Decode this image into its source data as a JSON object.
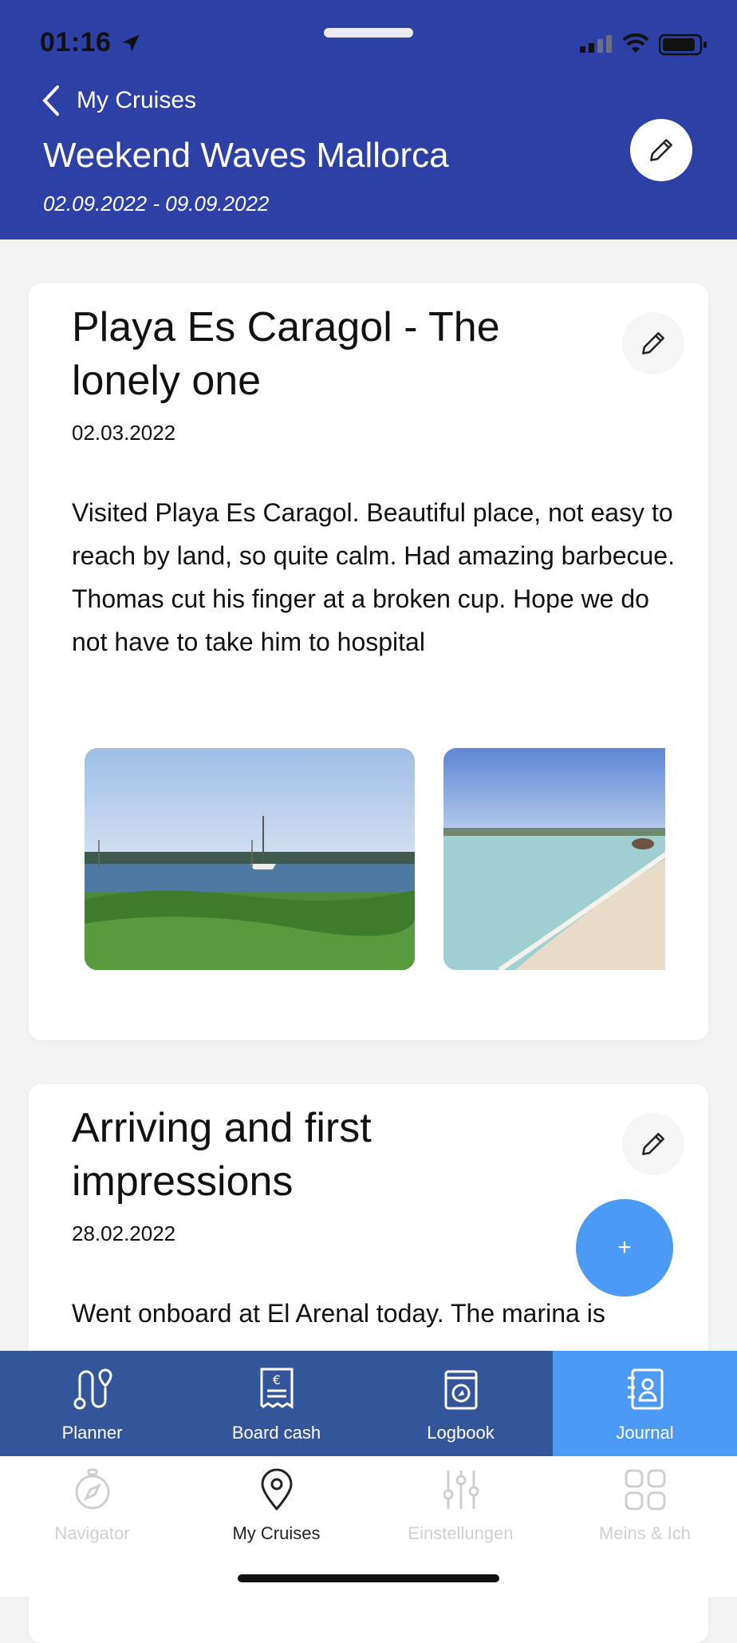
{
  "status": {
    "time": "01:16"
  },
  "header": {
    "back_label": "My Cruises",
    "title": "Weekend Waves Mallorca",
    "dates": "02.09.2022 - 09.09.2022"
  },
  "entries": [
    {
      "title": "Playa Es Caragol - The lonely one",
      "date": "02.03.2022",
      "text": "Visited Playa Es Caragol. Beautiful place, not easy to reach by land, so quite calm. Had amazing barbecue. Thomas cut his finger at a broken cup. Hope we do not have to take him to hospital"
    },
    {
      "title": "Arriving and first impressions",
      "date": "28.02.2022",
      "text": "Went onboard at El Arenal today. The marina is"
    }
  ],
  "fab": {
    "label": "+"
  },
  "modules": [
    {
      "label": "Planner",
      "icon": "route-icon"
    },
    {
      "label": "Board cash",
      "icon": "receipt-euro-icon"
    },
    {
      "label": "Logbook",
      "icon": "logbook-icon"
    },
    {
      "label": "Journal",
      "icon": "journal-icon"
    }
  ],
  "nav": [
    {
      "label": "Navigator",
      "icon": "compass-icon"
    },
    {
      "label": "My Cruises",
      "icon": "location-pin-icon"
    },
    {
      "label": "Einstellungen",
      "icon": "sliders-icon"
    },
    {
      "label": "Meins & Ich",
      "icon": "grid-icon"
    }
  ],
  "colors": {
    "header_bg": "#2c40a6",
    "modbar_bg": "#33569a",
    "accent": "#4b9af5"
  }
}
